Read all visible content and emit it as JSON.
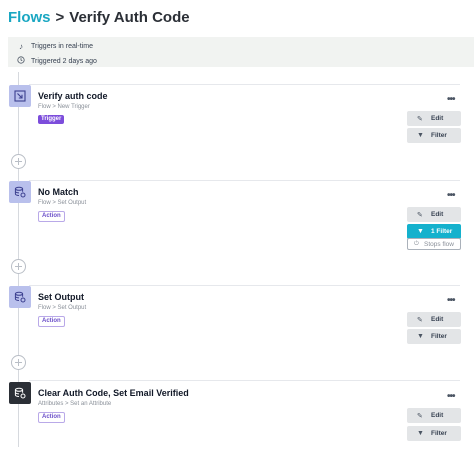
{
  "breadcrumb": {
    "parent": "Flows",
    "separator": ">",
    "current": "Verify Auth Code"
  },
  "trigger_info": {
    "mode": "Triggers in real-time",
    "last_triggered": "Triggered 2 days ago"
  },
  "steps": [
    {
      "title": "Verify auth code",
      "path": "Flow > New Trigger",
      "badge": "Trigger",
      "more_label": "•••",
      "edit_label": "Edit",
      "filter_label": "Filter"
    },
    {
      "title": "No Match",
      "path": "Flow > Set Output",
      "badge": "Action",
      "more_label": "•••",
      "edit_label": "Edit",
      "filter_label": "1 Filter",
      "stop_label": "Stops flow"
    },
    {
      "title": "Set Output",
      "path": "Flow > Set Output",
      "badge": "Action",
      "more_label": "•••",
      "edit_label": "Edit",
      "filter_label": "Filter"
    },
    {
      "title": "Clear Auth Code, Set Email Verified",
      "path": "Attributes > Set an Attribute",
      "badge": "Action",
      "more_label": "•••",
      "edit_label": "Edit",
      "filter_label": "Filter"
    }
  ],
  "icons": {
    "mode_icon": "music-note-icon",
    "time_icon": "clock-icon",
    "trigger_icon": "arrow-in-box-icon",
    "action_icon": "database-action-icon",
    "edit_icon": "pencil-icon",
    "filter_icon": "funnel-icon",
    "stop_icon": "power-icon",
    "add_icon": "plus-circle-icon"
  },
  "colors": {
    "brand": "#1aa7c2",
    "trigger_badge": "#7c4ddb",
    "active_filter": "#14b1cd",
    "step_icon": "#b9c0ec",
    "step_icon_dark": "#2b2f36"
  }
}
